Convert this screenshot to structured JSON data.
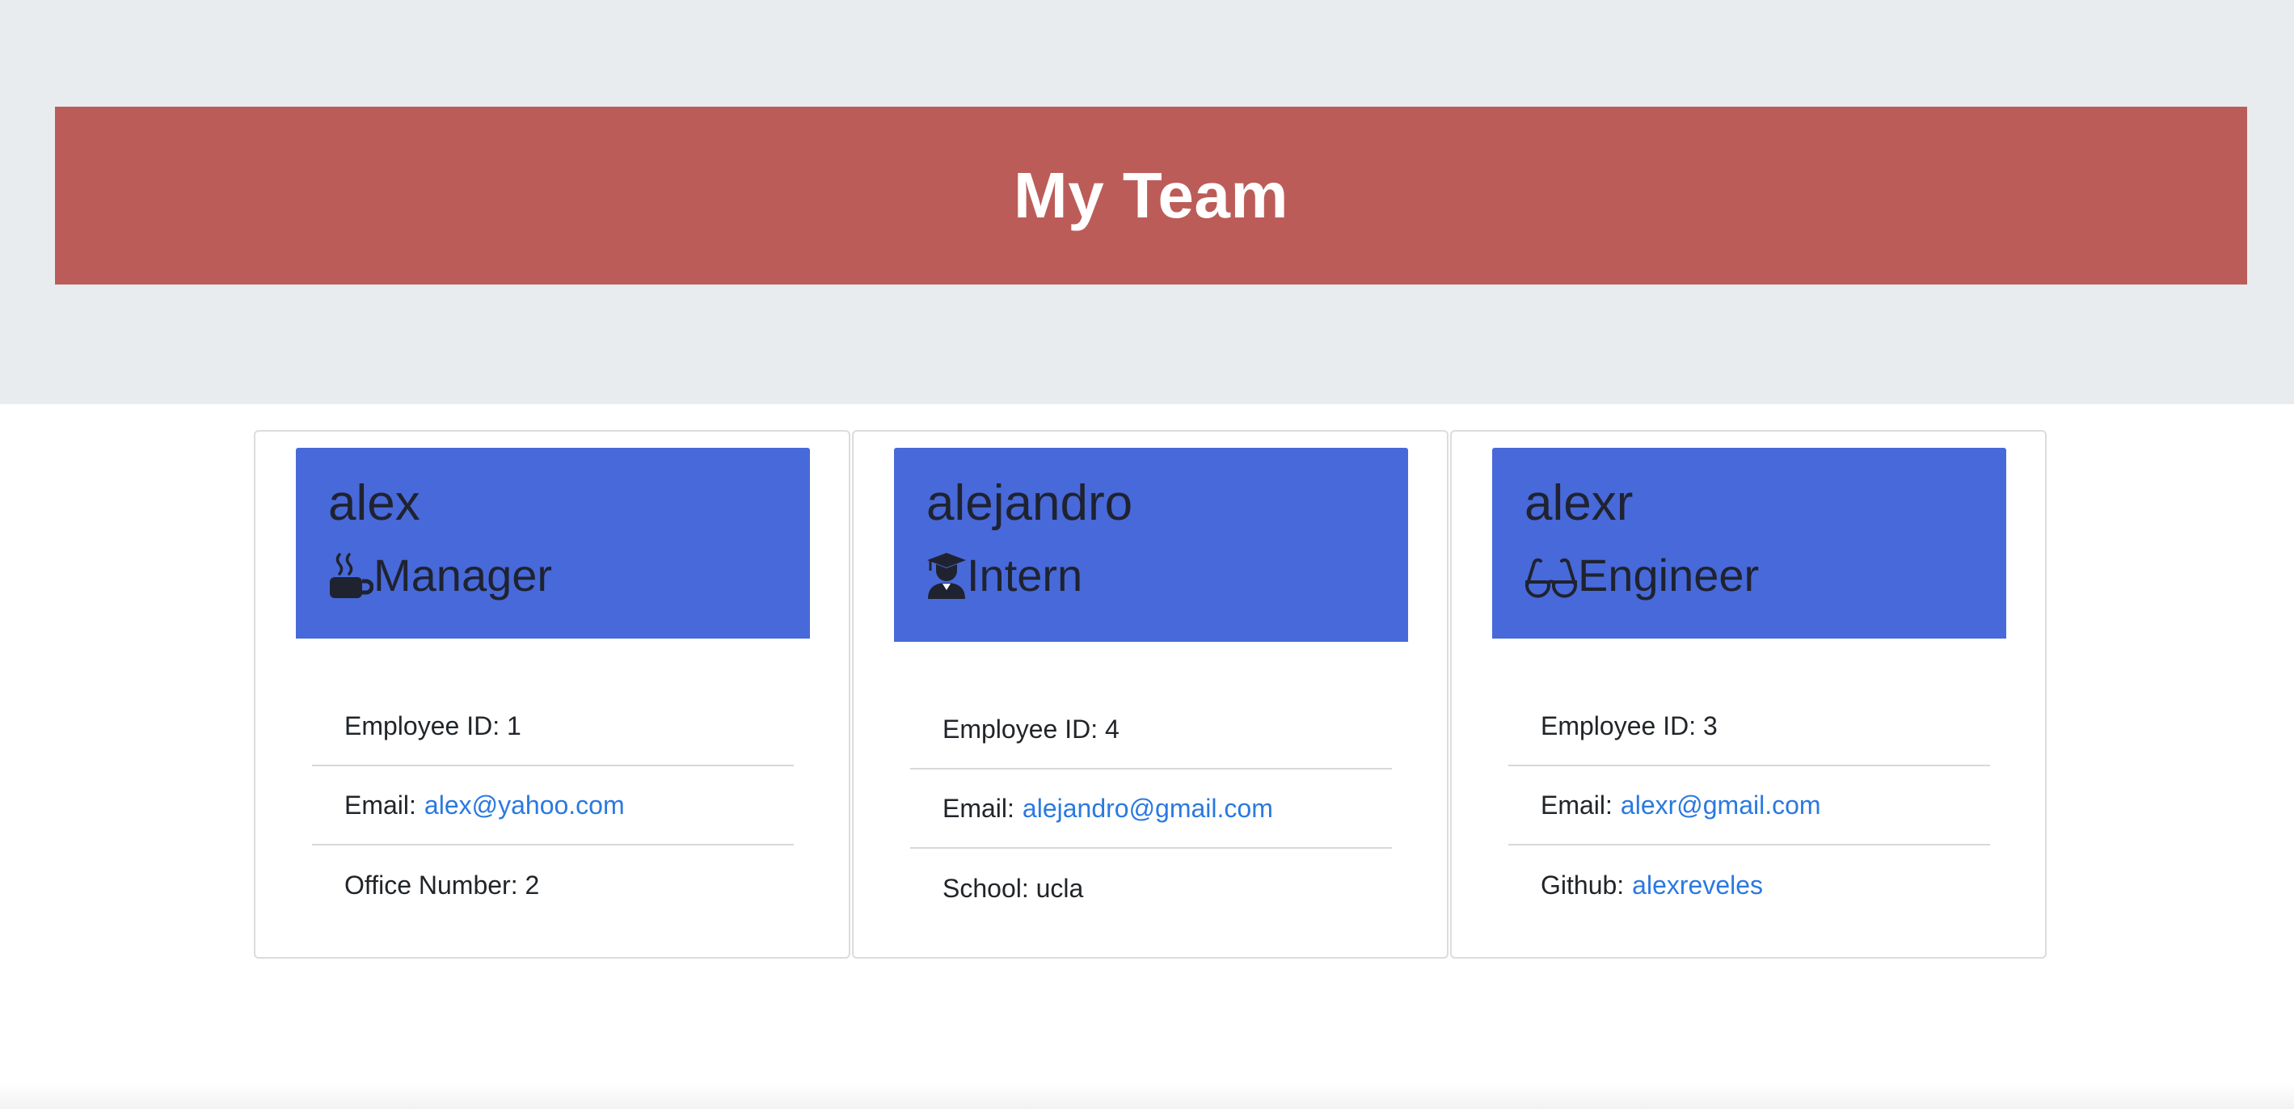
{
  "header": {
    "title": "My Team"
  },
  "colors": {
    "banner": "#bc5c58",
    "card_header": "#4869d9",
    "link": "#2a79e0",
    "jumbotron": "#e9ecef"
  },
  "cards": [
    {
      "name": "alex",
      "role": "Manager",
      "icon": "coffee-mug-icon",
      "id_label": "Employee ID: 1",
      "email_label": "Email:",
      "email": "alex@yahoo.com",
      "extra_label": "Office Number: 2",
      "extra_link": ""
    },
    {
      "name": "alejandro",
      "role": "Intern",
      "icon": "graduate-icon",
      "id_label": "Employee ID: 4",
      "email_label": "Email:",
      "email": "alejandro@gmail.com",
      "extra_label": "School: ucla",
      "extra_link": ""
    },
    {
      "name": "alexr",
      "role": "Engineer",
      "icon": "glasses-icon",
      "id_label": "Employee ID: 3",
      "email_label": "Email:",
      "email": "alexr@gmail.com",
      "extra_label": "Github:",
      "extra_link": "alexreveles"
    }
  ]
}
